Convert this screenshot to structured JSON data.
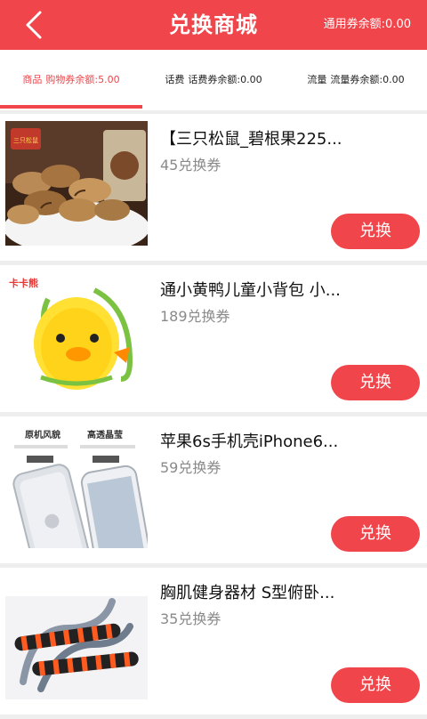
{
  "header": {
    "title": "兑换商城",
    "balance": "通用券余额:0.00",
    "colors": {
      "primary": "#f0454a"
    }
  },
  "tabs": [
    {
      "label": "商品",
      "balance": "购物券余额:5.00",
      "active": true
    },
    {
      "label": "话费",
      "balance": "话费券余额:0.00",
      "active": false
    },
    {
      "label": "流量",
      "balance": "流量券余额:0.00",
      "active": false
    }
  ],
  "items": [
    {
      "name": "【三只松鼠_碧根果225...",
      "price": "45兑换券",
      "button": "兑换",
      "image": "pecan-nuts-image",
      "image_text": "三只松鼠"
    },
    {
      "name": "通小黄鸭儿童小背包 小...",
      "price": "189兑换券",
      "button": "兑换",
      "image": "duck-backpack-image",
      "image_text": "卡卡熊"
    },
    {
      "name": "苹果6s手机壳iPhone6...",
      "price": "59兑换券",
      "button": "兑换",
      "image": "phone-case-image",
      "image_text_1": "原机风貌",
      "image_text_2": "高透晶莹"
    },
    {
      "name": "胸肌健身器材 S型俯卧...",
      "price": "35兑换券",
      "button": "兑换",
      "image": "pushup-bars-image"
    }
  ]
}
